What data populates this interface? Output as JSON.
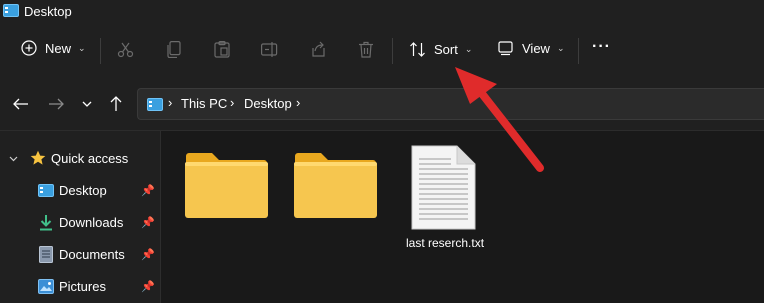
{
  "window": {
    "title": "Desktop"
  },
  "toolbar": {
    "new_label": "New",
    "sort_label": "Sort",
    "view_label": "View",
    "more_label": "···"
  },
  "navigation": {
    "breadcrumb": [
      "This PC",
      "Desktop"
    ],
    "separator": "›"
  },
  "sidebar": {
    "quick_access_label": "Quick access",
    "items": [
      {
        "label": "Desktop",
        "icon": "desktop-icon",
        "pinned": true
      },
      {
        "label": "Downloads",
        "icon": "download-icon",
        "pinned": true
      },
      {
        "label": "Documents",
        "icon": "document-icon",
        "pinned": true
      },
      {
        "label": "Pictures",
        "icon": "picture-icon",
        "pinned": true
      }
    ]
  },
  "content": {
    "items": [
      {
        "type": "folder",
        "label": ""
      },
      {
        "type": "folder",
        "label": ""
      },
      {
        "type": "file",
        "label": "last reserch.txt"
      }
    ]
  },
  "annotation": {
    "arrow_color": "#e02b2b",
    "points_to": "sort-button"
  },
  "colors": {
    "background": "#202020",
    "content_background": "#191919",
    "folder": "#f6c64f",
    "accent": "#4cc2ff"
  }
}
